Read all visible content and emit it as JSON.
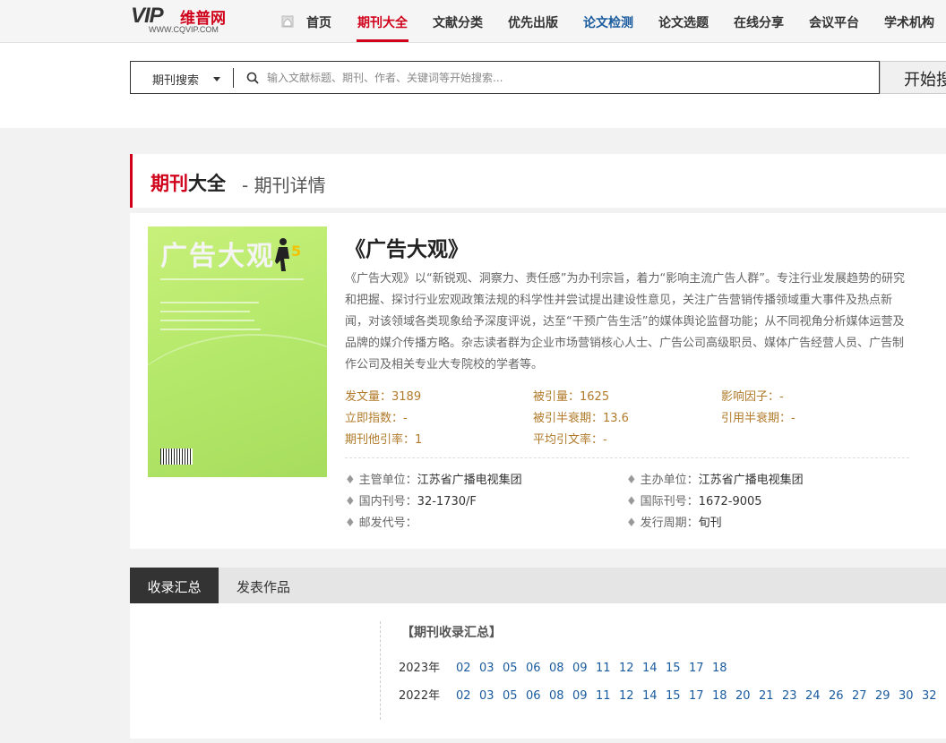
{
  "brand": {
    "logo_vip": "VIP",
    "logo_cn": "维普网",
    "logo_url": "WWW.CQVIP.COM"
  },
  "nav": {
    "items": [
      "首页",
      "期刊大全",
      "文献分类",
      "优先出版",
      "论文检测",
      "论文选题",
      "在线分享",
      "会议平台",
      "学术机构"
    ],
    "active": "期刊大全"
  },
  "search": {
    "type_label": "期刊搜索",
    "placeholder": "输入文献标题、期刊、作者、关键词等开始搜索...",
    "button": "开始搜"
  },
  "panel": {
    "title_red": "期刊",
    "title_black": "大全",
    "subtitle": "- 期刊详情"
  },
  "journal": {
    "cover_title": "广告大观",
    "cover_issue": "5",
    "name": "《广告大观》",
    "description": "《广告大观》以“新锐观、洞察力、责任感”为办刊宗旨，着力“影响主流广告人群”。专注行业发展趋势的研究和把握、探讨行业宏观政策法规的科学性并尝试提出建设性意见，关注广告营销传播领域重大事件及热点新闻，对该领域各类现象给予深度评说，达至“干预广告生活”的媒体舆论监督功能；从不同视角分析媒体运营及品牌的媒介传播方略。杂志读者群为企业市场营销核心人士、广告公司高级职员、媒体广告经营人员、广告制作公司及相关专业大专院校的学者等。",
    "stats": [
      "发文量：3189",
      "被引量：1625",
      "影响因子：-",
      "立即指数：-",
      "被引半衰期：13.6",
      "引用半衰期：-",
      "期刊他引率：1",
      "平均引文率：-"
    ],
    "info": [
      {
        "label": "主管单位：",
        "value": "江苏省广播电视集团"
      },
      {
        "label": "主办单位：",
        "value": "江苏省广播电视集团"
      },
      {
        "label": "国内刊号：",
        "value": "32-1730/F"
      },
      {
        "label": "国际刊号：",
        "value": "1672-9005"
      },
      {
        "label": "邮发代号：",
        "value": ""
      },
      {
        "label": "发行周期：",
        "value": "旬刊"
      }
    ]
  },
  "tabs": [
    "收录汇总",
    "发表作品"
  ],
  "collection": {
    "title": "【期刊收录汇总】",
    "years": [
      {
        "year": "2023年",
        "issues": [
          "02",
          "03",
          "05",
          "06",
          "08",
          "09",
          "11",
          "12",
          "14",
          "15",
          "17",
          "18"
        ]
      },
      {
        "year": "2022年",
        "issues": [
          "02",
          "03",
          "05",
          "06",
          "08",
          "09",
          "11",
          "12",
          "14",
          "15",
          "17",
          "18",
          "20",
          "21",
          "23",
          "24",
          "26",
          "27",
          "29",
          "30",
          "32"
        ]
      }
    ]
  },
  "colors": {
    "accent": "#d0021b",
    "link": "#1a5b9e",
    "stat": "#b07a2a"
  }
}
